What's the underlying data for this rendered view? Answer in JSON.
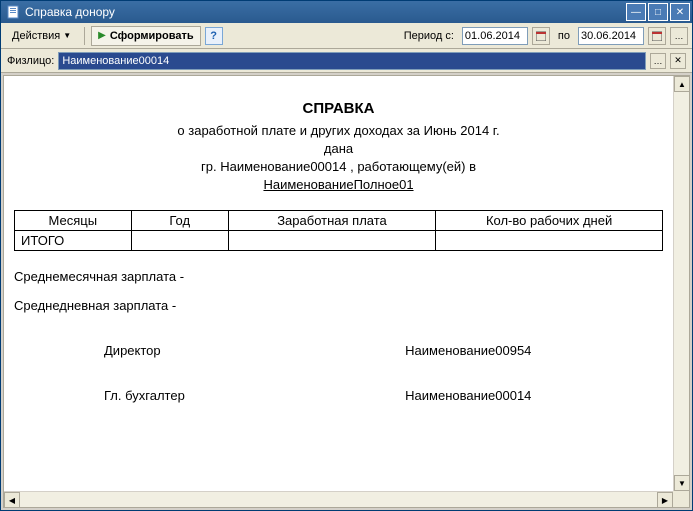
{
  "window": {
    "title": "Справка донору"
  },
  "toolbar": {
    "actions_label": "Действия",
    "form_label": "Сформировать",
    "period_from_label": "Период с:",
    "period_to_label": "по",
    "date_from": "01.06.2014",
    "date_to": "30.06.2014"
  },
  "filter": {
    "person_label": "Физлицо:",
    "person_value": "Наименование00014"
  },
  "doc": {
    "title": "СПРАВКА",
    "subtitle": "о заработной плате и других доходах  за Июнь 2014 г.",
    "given": "дана",
    "citizen_line_prefix": "гр. ",
    "citizen_name": "Наименование00014",
    "citizen_line_suffix": "  , работающему(ей) в",
    "org": "НаименованиеПолное01",
    "headers": {
      "month": "Месяцы",
      "year": "Год",
      "salary": "Заработная  плата",
      "days": "Кол-во рабочих дней"
    },
    "total_label": "ИТОГО",
    "avg_month": "Среднемесячная зарплата -",
    "avg_day": "Среднедневная зарплата -",
    "sign": {
      "director_role": "Директор",
      "director_name": "Наименование00954",
      "accountant_role": "Гл. бухгалтер",
      "accountant_name": "Наименование00014"
    }
  }
}
